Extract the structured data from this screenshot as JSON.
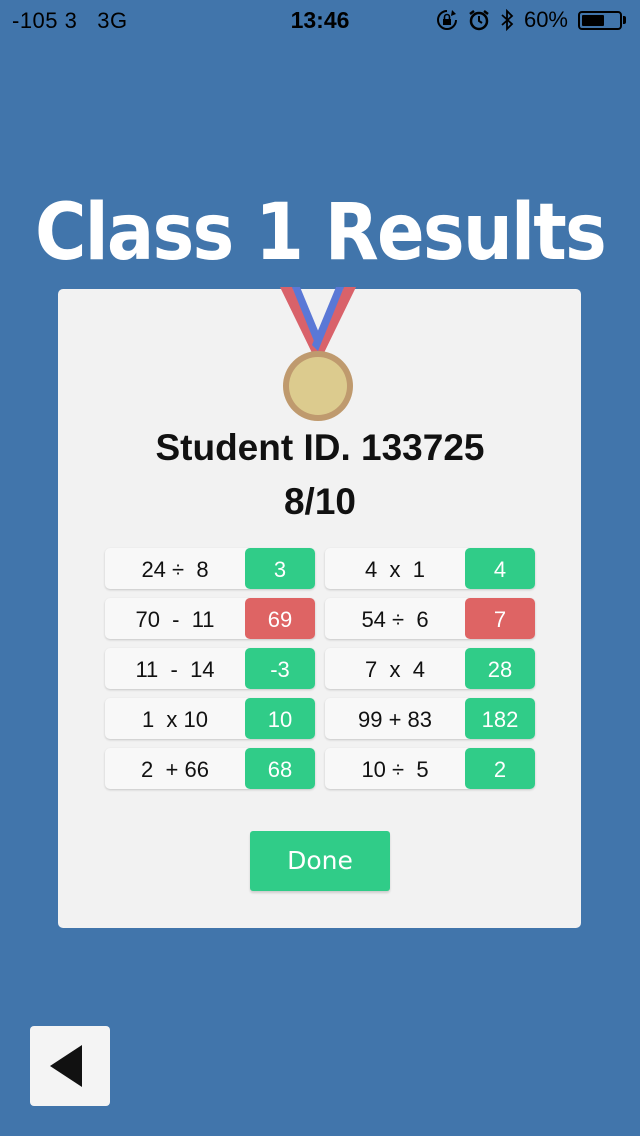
{
  "status_bar": {
    "carrier": "-105 3",
    "network": "3G",
    "time": "13:46",
    "battery_percent": "60%",
    "battery_level": 0.6,
    "icons": [
      "rotation-lock-icon",
      "alarm-icon",
      "bluetooth-icon",
      "battery-icon"
    ]
  },
  "page": {
    "title": "Class 1 Results"
  },
  "result": {
    "student_id": "Student ID. 133725",
    "score": "8/10"
  },
  "questions": [
    {
      "question": "24 ÷  8",
      "answer": "3",
      "correct": true
    },
    {
      "question": "4  x  1",
      "answer": "4",
      "correct": true
    },
    {
      "question": "70  -  11",
      "answer": "69",
      "correct": false
    },
    {
      "question": "54 ÷  6",
      "answer": "7",
      "correct": false
    },
    {
      "question": "11  -  14",
      "answer": "-3",
      "correct": true
    },
    {
      "question": "7  x  4",
      "answer": "28",
      "correct": true
    },
    {
      "question": "1  x 10",
      "answer": "10",
      "correct": true
    },
    {
      "question": "99 + 83",
      "answer": "182",
      "correct": true
    },
    {
      "question": "2  + 66",
      "answer": "68",
      "correct": true
    },
    {
      "question": "10 ÷  5",
      "answer": "2",
      "correct": true
    }
  ],
  "buttons": {
    "done_label": "Done",
    "back_icon": "back-triangle-icon"
  },
  "colors": {
    "background": "#4175ab",
    "correct": "#30cc88",
    "incorrect": "#de6464",
    "medal_gold": "#dccb8e",
    "medal_rim": "#bf9a6e",
    "ribbon_red": "#d9626a",
    "ribbon_blue": "#5a78d6"
  }
}
